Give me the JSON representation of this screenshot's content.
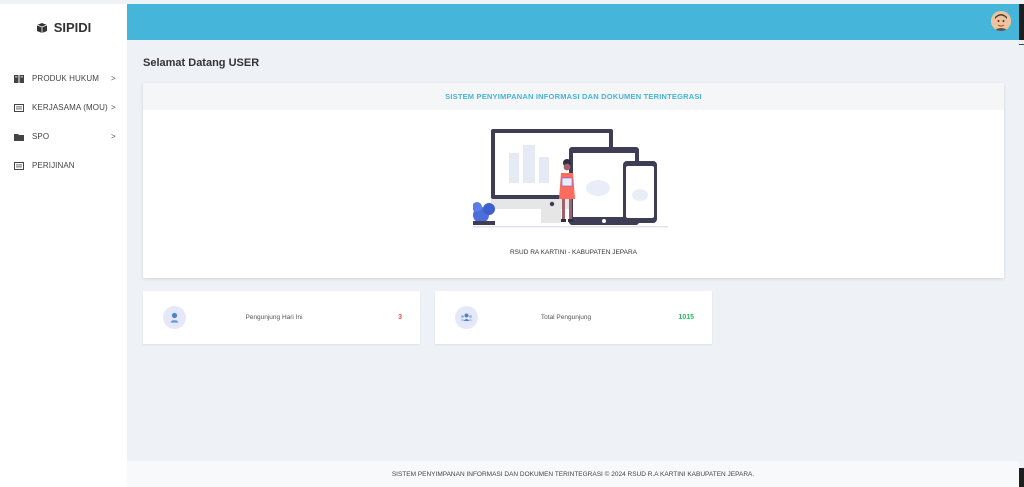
{
  "brand": {
    "name": "SIPIDI",
    "logo_icon": "box-open-icon"
  },
  "sidebar": {
    "items": [
      {
        "label": "PRODUK HUKUM",
        "icon": "book-icon",
        "has_submenu": true,
        "chevron": ">"
      },
      {
        "label": "KERJASAMA (MOU)",
        "icon": "file-icon",
        "has_submenu": true,
        "chevron": ">"
      },
      {
        "label": "SPO",
        "icon": "folder-icon",
        "has_submenu": true,
        "chevron": ">"
      },
      {
        "label": "PERIJINAN",
        "icon": "file-icon",
        "has_submenu": false,
        "chevron": ""
      }
    ]
  },
  "topbar": {
    "color": "#45b6d9",
    "avatar_icon": "user-avatar-icon"
  },
  "page": {
    "title": "Selamat Datang USER"
  },
  "hero": {
    "header": "SISTEM PENYIMPANAN INFORMASI DAN DOKUMEN TERINTEGRASI",
    "caption": "RSUD RA KARTINI - KABUPATEN JEPARA"
  },
  "stats": [
    {
      "label": "Pengunjung Hari Ini",
      "value": "3",
      "value_color": "#e55353",
      "icon": "user-tie-icon"
    },
    {
      "label": "Total Pengunjung",
      "value": "1015",
      "value_color": "#2eb85c",
      "icon": "users-icon"
    }
  ],
  "footer": {
    "text": "SISTEM PENYIMPANAN INFORMASI DAN DOKUMEN TERINTEGRASI © 2024 RSUD R.A KARTINI KABUPATEN JEPARA."
  }
}
